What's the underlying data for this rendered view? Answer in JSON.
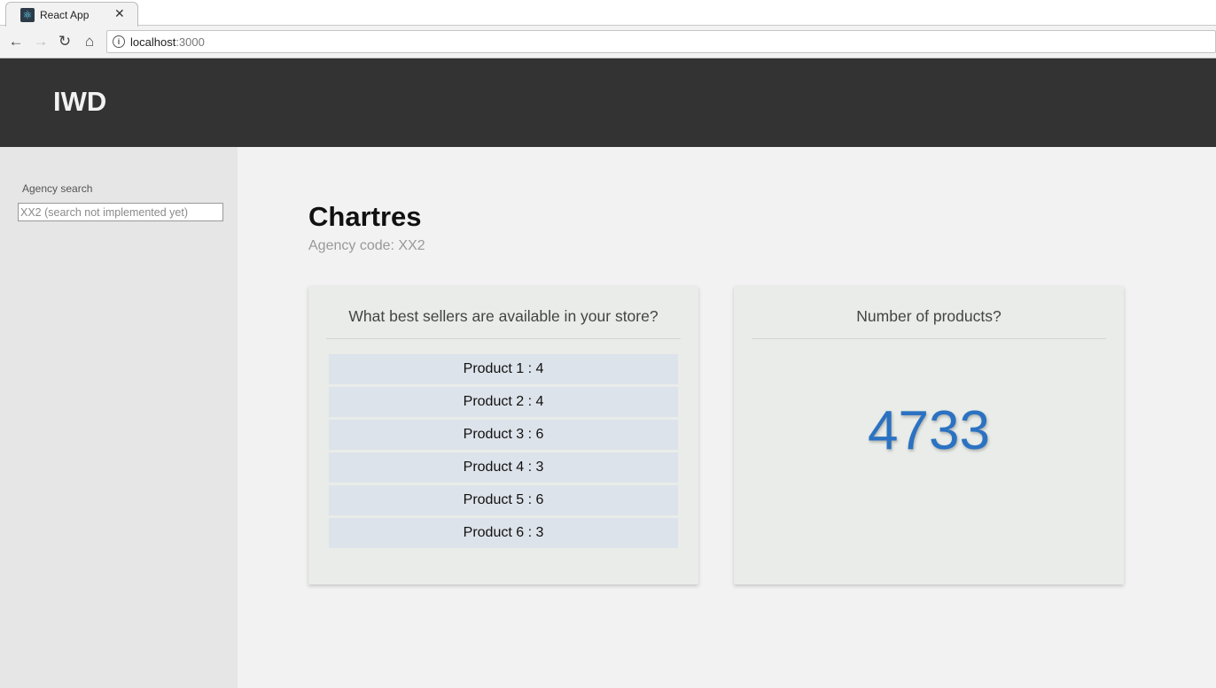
{
  "browser": {
    "tab_title": "React App",
    "favicon_glyph": "⚛",
    "close_glyph": "✕",
    "nav": {
      "back": "←",
      "forward": "→",
      "reload": "↻",
      "home": "⌂"
    },
    "info_glyph": "i",
    "url_host": "localhost",
    "url_port": ":3000"
  },
  "header": {
    "brand": "IWD"
  },
  "sidebar": {
    "search_label": "Agency search",
    "search_placeholder": "XX2 (search not implemented yet)"
  },
  "agency": {
    "name": "Chartres",
    "code_text": "Agency code: XX2"
  },
  "best_sellers": {
    "title": "What best sellers are available in your store?",
    "items": [
      "Product 1 : 4",
      "Product 2 : 4",
      "Product 3 : 6",
      "Product 4 : 3",
      "Product 5 : 6",
      "Product 6 : 3"
    ]
  },
  "products_count": {
    "title": "Number of products?",
    "value": "4733"
  },
  "colors": {
    "header_bg": "#333333",
    "accent_number": "#2b72c2",
    "card_bg": "#e9ece8",
    "list_item_bg": "#dde3ea"
  }
}
